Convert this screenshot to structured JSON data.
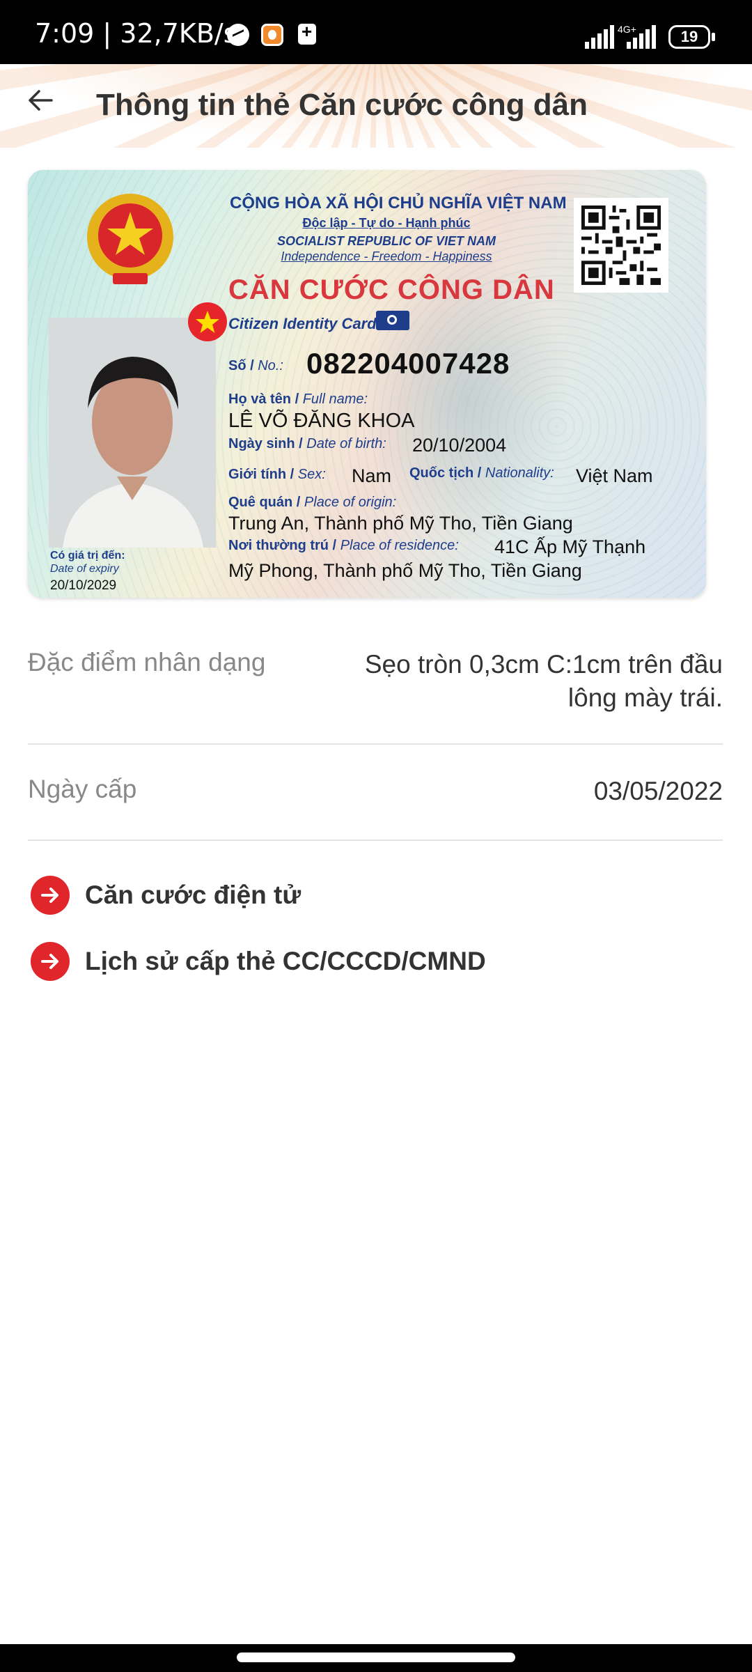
{
  "status_bar": {
    "time": "7:09 | 32,7KB/s",
    "network": "4G+",
    "battery": "19"
  },
  "header": {
    "title": "Thông tin thẻ Căn cước công dân"
  },
  "card": {
    "header_line1": "CỘNG HÒA XÃ HỘI CHỦ NGHĨA VIỆT NAM",
    "header_line2": "Độc lập - Tự do - Hạnh phúc",
    "header_line3": "SOCIALIST REPUBLIC OF VIET NAM",
    "header_line4": "Independence - Freedom - Happiness",
    "title": "CĂN CƯỚC CÔNG DÂN",
    "subtitle": "Citizen Identity Card",
    "no_label_vi": "Số /",
    "no_label_en": "No.:",
    "no_value": "082204007428",
    "name_label_vi": "Họ và tên /",
    "name_label_en": "Full name:",
    "name_value": "LÊ VÕ ĐĂNG KHOA",
    "dob_label_vi": "Ngày sinh /",
    "dob_label_en": "Date of birth:",
    "dob_value": "20/10/2004",
    "sex_label_vi": "Giới tính /",
    "sex_label_en": "Sex:",
    "sex_value": "Nam",
    "nationality_label_vi": "Quốc tịch /",
    "nationality_label_en": "Nationality:",
    "nationality_value": "Việt Nam",
    "origin_label_vi": "Quê quán /",
    "origin_label_en": "Place of origin:",
    "origin_value": "Trung An, Thành phố Mỹ Tho, Tiền Giang",
    "residence_label_vi": "Nơi thường trú /",
    "residence_label_en": "Place of residence:",
    "residence_value_line1": "41C Ấp Mỹ Thạnh",
    "residence_value_line2": "Mỹ Phong, Thành phố Mỹ Tho, Tiền Giang",
    "expiry_label_vi": "Có giá trị đến:",
    "expiry_label_en": "Date of expiry",
    "expiry_value": "20/10/2029"
  },
  "details": {
    "features_label": "Đặc điểm nhân dạng",
    "features_value_line1": "Sẹo tròn 0,3cm C:1cm trên đầu",
    "features_value_line2": "lông mày trái.",
    "issue_date_label": "Ngày cấp",
    "issue_date_value": "03/05/2022"
  },
  "links": [
    {
      "label": "Căn cước điện tử",
      "icon": "arrow-right-icon"
    },
    {
      "label": "Lịch sử cấp thẻ CC/CCCD/CMND",
      "icon": "arrow-right-icon"
    }
  ],
  "colors": {
    "accent_red": "#e0252b",
    "card_red": "#d7373d",
    "card_blue": "#1e3e8c"
  }
}
